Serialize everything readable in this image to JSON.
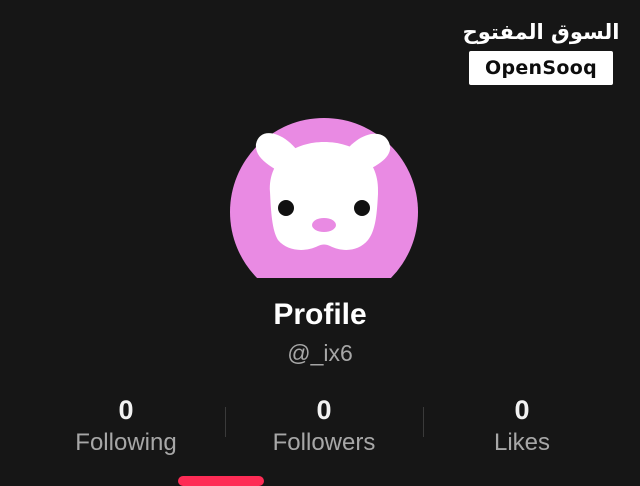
{
  "watermark": {
    "arabic": "السوق المفتوح",
    "brand": "OpenSooq"
  },
  "avatar": {
    "icon": "bunny-avatar-icon",
    "background_color": "#e98ae3",
    "face_color": "#ffffff",
    "nose_color": "#e98ae3"
  },
  "profile": {
    "name": "Profile",
    "handle": "@_ix6"
  },
  "stats": [
    {
      "value": "0",
      "label": "Following"
    },
    {
      "value": "0",
      "label": "Followers"
    },
    {
      "value": "0",
      "label": "Likes"
    }
  ],
  "colors": {
    "background": "#161616",
    "accent": "#fe2c55",
    "muted_text": "#a7a7a7"
  }
}
